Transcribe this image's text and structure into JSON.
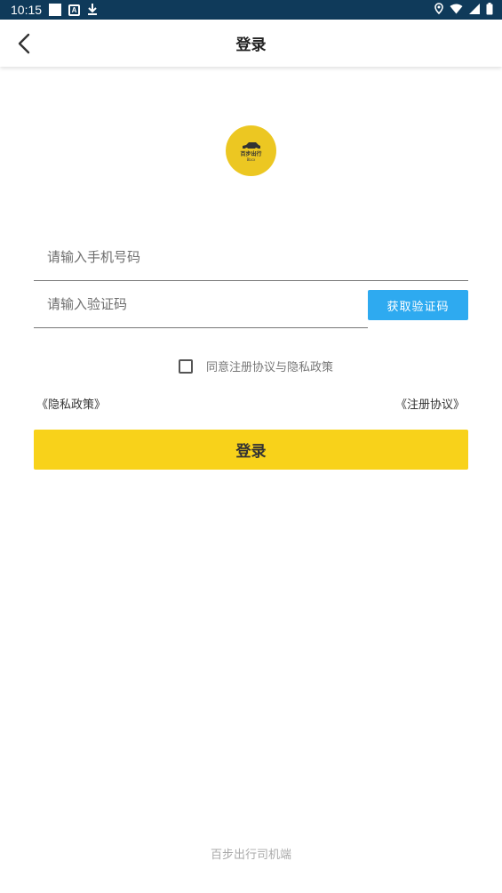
{
  "status_bar": {
    "time": "10:15",
    "icons": [
      "notification-square-icon",
      "a-icon",
      "download-icon",
      "location-icon",
      "wifi-icon",
      "signal-icon",
      "battery-icon"
    ]
  },
  "header": {
    "title": "登录",
    "back_icon": "back-arrow-icon"
  },
  "logo": {
    "text": "百步出行",
    "sub": "Bbcx",
    "color": "#ecc722"
  },
  "form": {
    "phone_placeholder": "请输入手机号码",
    "phone_value": "",
    "code_placeholder": "请输入验证码",
    "code_value": "",
    "get_code_label": "获取验证码",
    "agree_checked": false,
    "agree_label": "同意注册协议与隐私政策",
    "privacy_link": "《隐私政策》",
    "register_link": "《注册协议》",
    "login_label": "登录"
  },
  "footer": {
    "text": "百步出行司机端"
  },
  "colors": {
    "status_bar": "#0f3a5a",
    "accent_yellow": "#f8d21a",
    "code_button": "#2eaaf0"
  }
}
